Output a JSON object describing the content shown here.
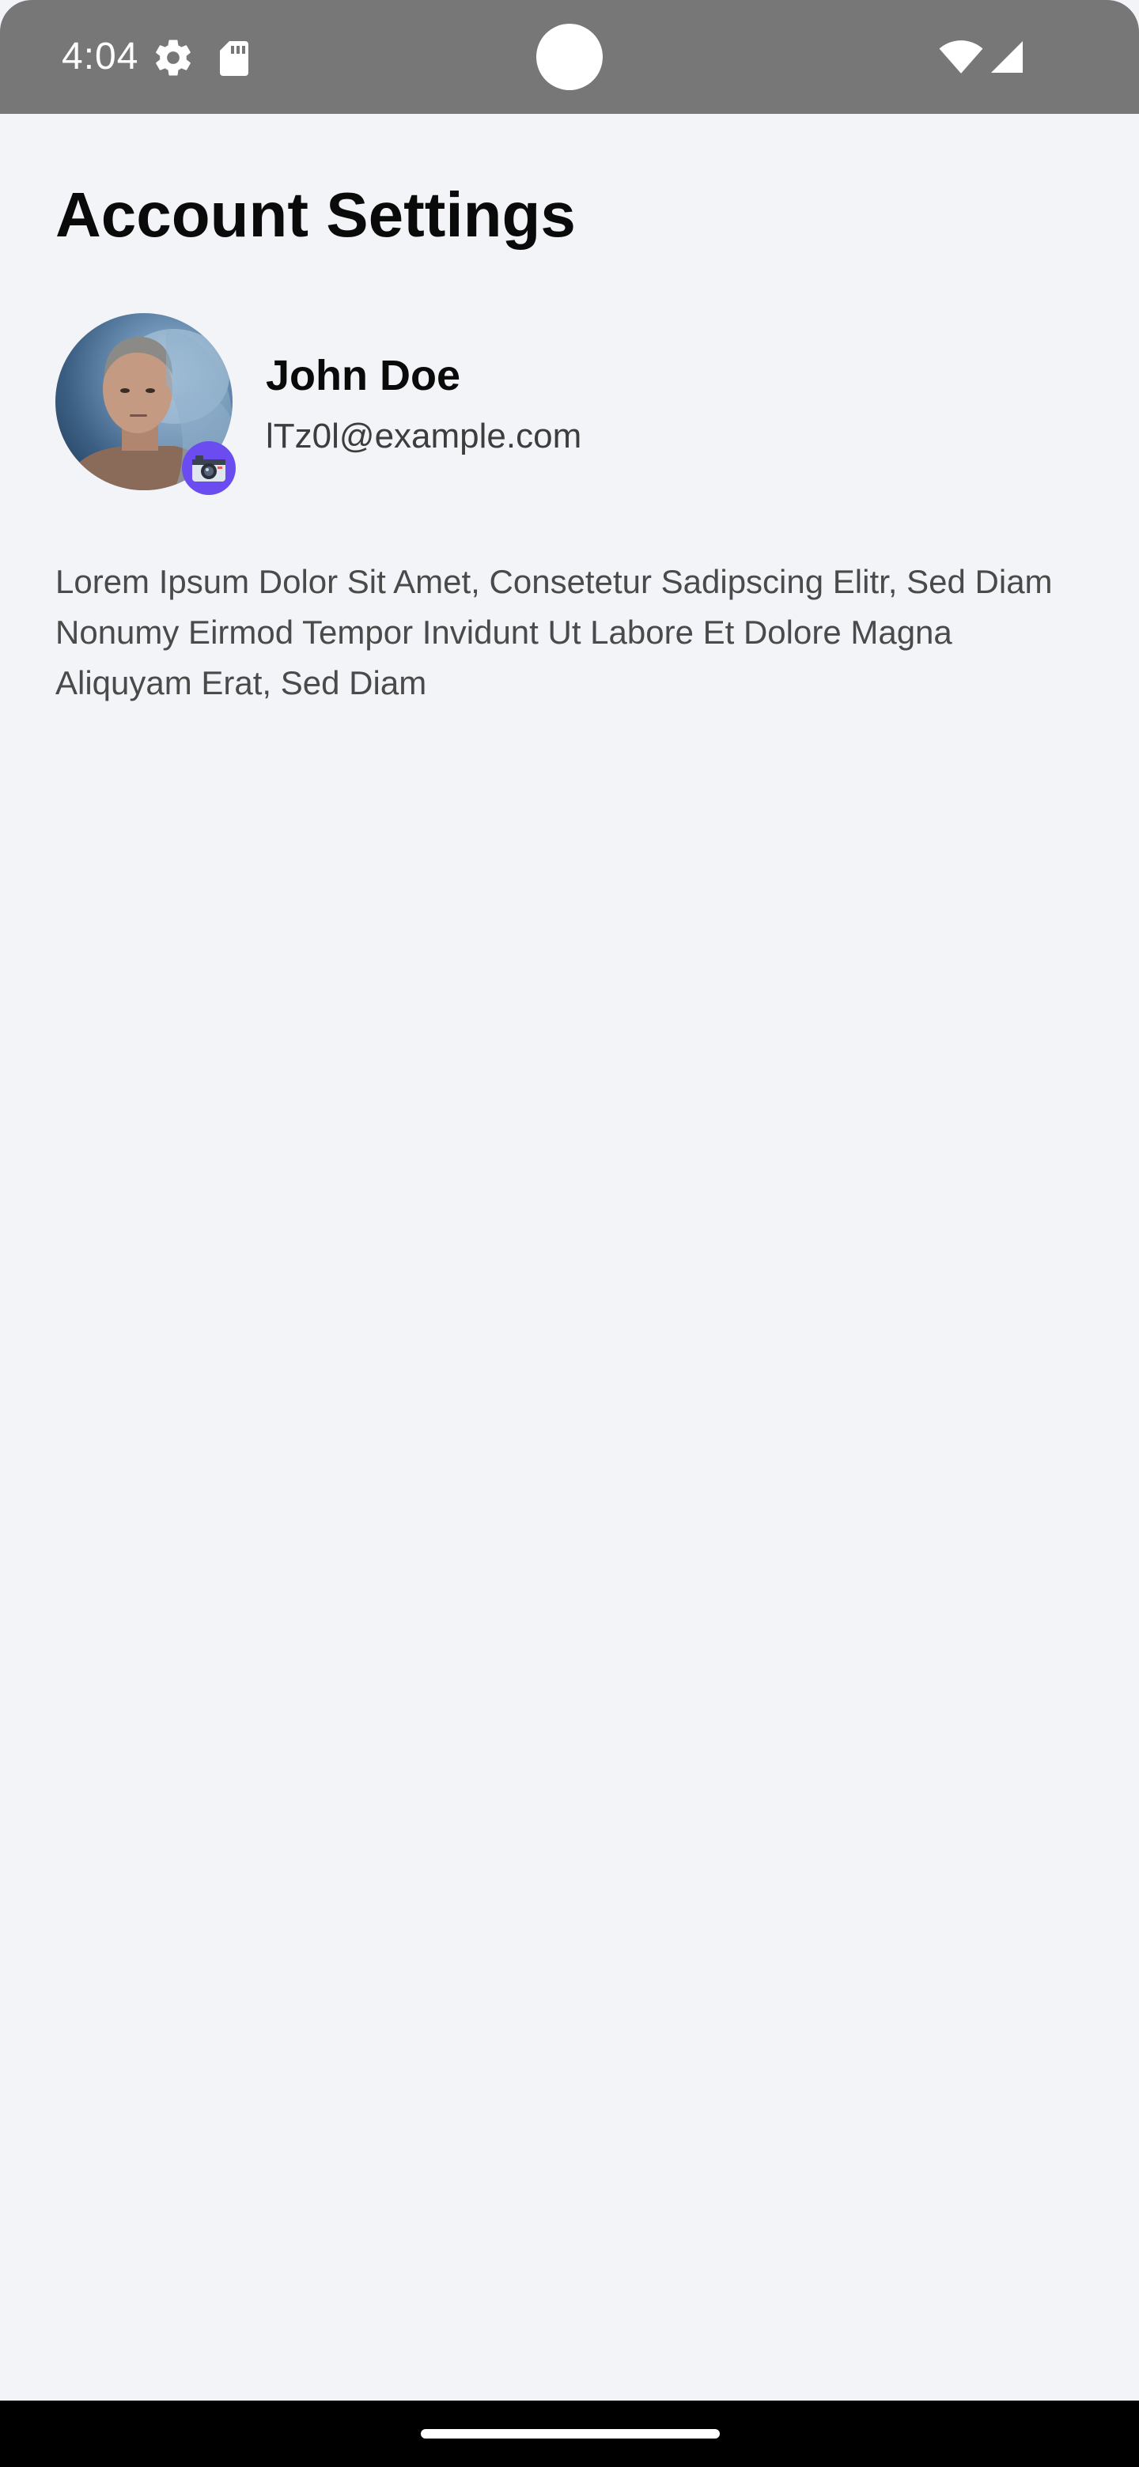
{
  "status_bar": {
    "time": "4:04",
    "icons": [
      "gear-icon",
      "sd-card-icon",
      "wifi-icon",
      "cellular-signal-icon"
    ]
  },
  "page": {
    "title": "Account Settings"
  },
  "profile": {
    "name": "John Doe",
    "email": "lTz0l@example.com",
    "avatar_badge_icon": "camera-icon",
    "badge_color": "#6a4cf0"
  },
  "description": "Lorem Ipsum Dolor Sit Amet, Consetetur Sadipscing Elitr, Sed Diam Nonumy Eirmod Tempor Invidunt Ut Labore Et Dolore Magna Aliquyam Erat, Sed Diam",
  "colors": {
    "background": "#f3f4f8",
    "status_bar": "#777777",
    "nav_bar": "#000000"
  }
}
